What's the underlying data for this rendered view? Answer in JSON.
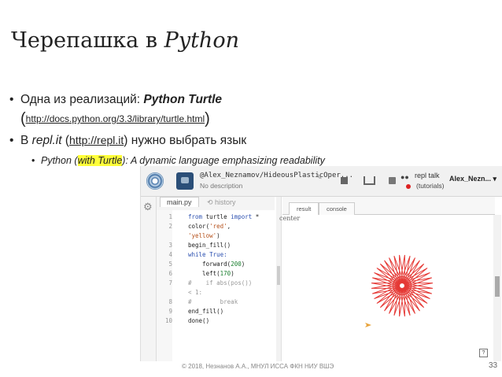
{
  "slide": {
    "title_plain": "Черепашка в ",
    "title_italic": "Python",
    "bullet1_text": "Одна из реализаций: ",
    "bullet1_bold": "Python Turtle",
    "bullet1_open": "(",
    "bullet1_link": "http://docs.python.org/3.3/library/turtle.html",
    "bullet1_close": ")",
    "bullet2_pre": "В ",
    "bullet2_italic": "repl.it",
    "bullet2_open": " (",
    "bullet2_link": "http://repl.it",
    "bullet2_post": ") нужно выбрать язык",
    "bullet3_pre": "Python (",
    "bullet3_hl": "with Turtle",
    "bullet3_post": "): A dynamic language emphasizing readability",
    "footer": "© 2018, Незнанов А.А., МНУЛ ИССА ФКН НИУ ВШЭ",
    "page_number": "33",
    "bullet_glyph": "•"
  },
  "repl": {
    "project_name": "@Alex_Neznamov/HideousPlasticOper...",
    "description": "No description",
    "repl_talk": "repl talk",
    "tutorials": "(tutorials)",
    "user": "Alex_Nezn... ▾",
    "file_tab": "main.py",
    "history_tab": "history",
    "result_tab": "result",
    "console_tab": "console",
    "canvas_label": "center",
    "help_button": "?",
    "line_numbers": [
      "1",
      "2",
      "3",
      "4",
      "5",
      "6",
      "7",
      "8",
      "9",
      "10"
    ],
    "code": {
      "l1_kw1": "from",
      "l1_mid": " turtle ",
      "l1_kw2": "import",
      "l1_end": " *",
      "l2_a": "color(",
      "l2_s1": "'red'",
      "l2_b": ",",
      "l2c_s2": "'yellow'",
      "l2c_end": ")",
      "l3": "begin_fill()",
      "l4_kw": "while",
      "l4_rest": " True:",
      "l5_a": "    forward(",
      "l5_n": "200",
      "l5_b": ")",
      "l6_a": "    left(",
      "l6_n": "170",
      "l6_b": ")",
      "l7": "#    if abs(pos())",
      "l7c": "< 1:",
      "l8": "#        break",
      "l9": "end_fill()",
      "l10": "done()"
    },
    "colors": {
      "star_stroke": "#e53935",
      "star_fill": "#ffd600",
      "turtle_cursor": "#e8a33a"
    },
    "star": {
      "step_length": 200,
      "turn_angle": 170,
      "point_count": 36
    }
  },
  "icons": [
    "repl-logo-icon",
    "avatar-icon",
    "pencil-icon",
    "stop-icon",
    "share-icon",
    "save-icon",
    "repl-talk-icon",
    "gear-icon",
    "history-icon",
    "help-icon",
    "turtle-cursor-icon"
  ]
}
